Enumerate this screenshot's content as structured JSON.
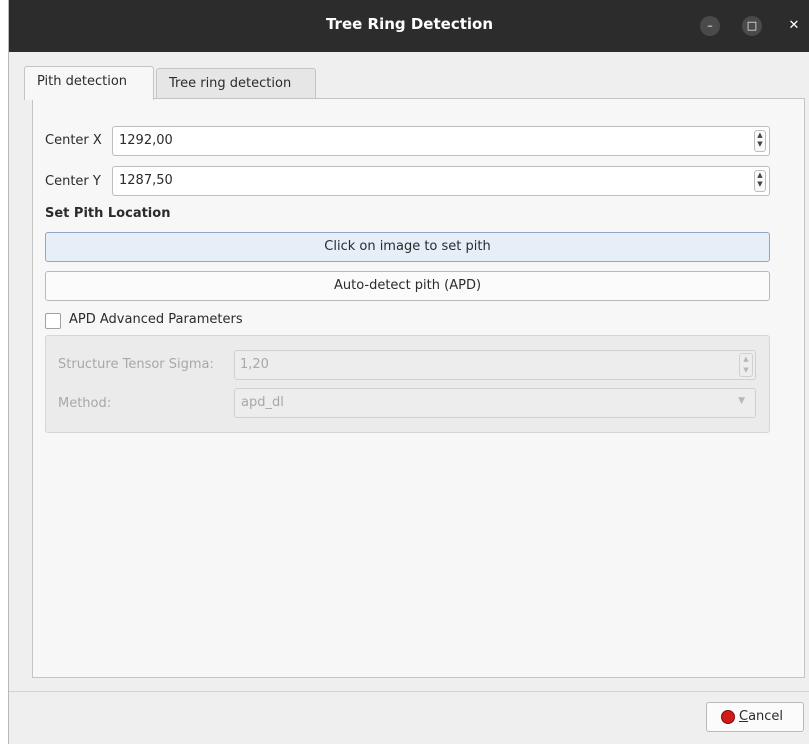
{
  "window": {
    "title": "Tree Ring Detection",
    "controls": {
      "minimize": "–",
      "maximize": "□",
      "close": "✕"
    }
  },
  "tabs": [
    {
      "label": "Pith detection",
      "active": true
    },
    {
      "label": "Tree ring detection",
      "active": false
    }
  ],
  "pith": {
    "center_x_label": "Center X",
    "center_x_value": "1292,00",
    "center_y_label": "Center Y",
    "center_y_value": "1287,50",
    "section_label": "Set Pith Location",
    "click_button": "Click on image to set pith",
    "auto_button": "Auto-detect pith (APD)",
    "advanced_checkbox_label": "APD Advanced Parameters",
    "advanced_checked": false,
    "advanced": {
      "sigma_label": "Structure Tensor Sigma:",
      "sigma_value": "1,20",
      "method_label": "Method:",
      "method_value": "apd_dl"
    }
  },
  "footer": {
    "cancel_label": "Cancel"
  },
  "colors": {
    "titlebar": "#2c2c2c",
    "cancel_icon": "#d11b1b"
  },
  "icons": {
    "spin_arrows": "▲▼",
    "combo_caret": "▼"
  }
}
